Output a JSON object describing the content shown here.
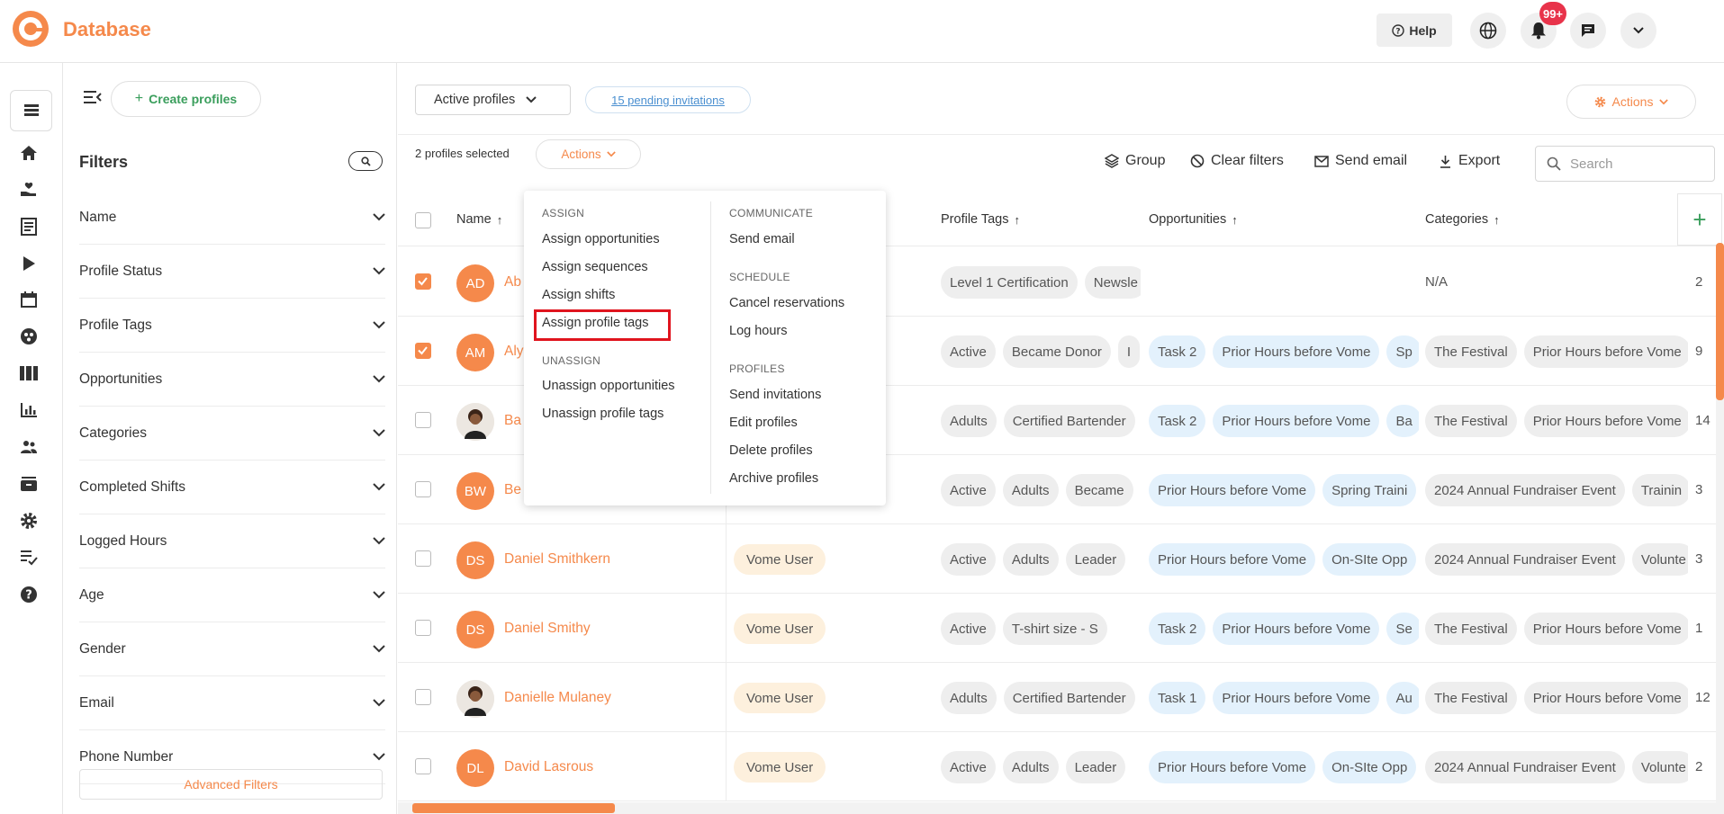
{
  "app": {
    "brand": "Database"
  },
  "header": {
    "help_label": "Help",
    "notif_badge": "99+"
  },
  "sidebar": {
    "create_label": "Create profiles",
    "filters_title": "Filters",
    "filters": [
      "Name",
      "Profile Status",
      "Profile Tags",
      "Opportunities",
      "Categories",
      "Completed Shifts",
      "Logged Hours",
      "Age",
      "Gender",
      "Email",
      "Phone Number"
    ],
    "advanced_label": "Advanced Filters"
  },
  "toolbar": {
    "view_select": "Active profiles",
    "pending_link": "15 pending invitations",
    "actions_label": "Actions",
    "selected_text": "2 profiles selected",
    "sel_actions_label": "Actions",
    "group_label": "Group",
    "clear_label": "Clear filters",
    "email_label": "Send email",
    "export_label": "Export",
    "search_placeholder": "Search"
  },
  "table": {
    "headers": {
      "name": "Name",
      "tags": "Profile Tags",
      "opps": "Opportunities",
      "cats": "Categories"
    },
    "rows": [
      {
        "initials": "AD",
        "name": "Ab",
        "checked": true,
        "role": "",
        "tags": [
          "Level 1 Certification",
          "Newsle"
        ],
        "opps": [],
        "cats": [
          "N/A"
        ],
        "extra": "2",
        "photo": false
      },
      {
        "initials": "AM",
        "name": "Aly",
        "checked": true,
        "role": "",
        "tags": [
          "Active",
          "Became Donor",
          "I"
        ],
        "opps": [
          "Task 2",
          "Prior Hours before Vome",
          "Sp"
        ],
        "cats": [
          "The Festival",
          "Prior Hours before Vome"
        ],
        "extra": "9",
        "photo": false
      },
      {
        "initials": "",
        "name": "Ba",
        "checked": false,
        "role": "",
        "tags": [
          "Adults",
          "Certified Bartender"
        ],
        "opps": [
          "Task 2",
          "Prior Hours before Vome",
          "Ba"
        ],
        "cats": [
          "The Festival",
          "Prior Hours before Vome"
        ],
        "extra": "14",
        "photo": true
      },
      {
        "initials": "BW",
        "name": "Be",
        "checked": false,
        "role": "",
        "tags": [
          "Active",
          "Adults",
          "Became"
        ],
        "opps": [
          "Prior Hours before Vome",
          "Spring Traini"
        ],
        "cats": [
          "2024 Annual Fundraiser Event",
          "Trainin"
        ],
        "extra": "3",
        "photo": false
      },
      {
        "initials": "DS",
        "name": "Daniel Smithkern",
        "checked": false,
        "role": "Vome User",
        "tags": [
          "Active",
          "Adults",
          "Leader"
        ],
        "opps": [
          "Prior Hours before Vome",
          "On-SIte Opp"
        ],
        "cats": [
          "2024 Annual Fundraiser Event",
          "Volunte"
        ],
        "extra": "3",
        "photo": false
      },
      {
        "initials": "DS",
        "name": "Daniel Smithy",
        "checked": false,
        "role": "Vome User",
        "tags": [
          "Active",
          "T-shirt size - S"
        ],
        "opps": [
          "Task 2",
          "Prior Hours before Vome",
          "Se"
        ],
        "cats": [
          "The Festival",
          "Prior Hours before Vome"
        ],
        "extra": "1",
        "photo": false
      },
      {
        "initials": "",
        "name": "Danielle Mulaney",
        "checked": false,
        "role": "Vome User",
        "tags": [
          "Adults",
          "Certified Bartender"
        ],
        "opps": [
          "Task 1",
          "Prior Hours before Vome",
          "Au"
        ],
        "cats": [
          "The Festival",
          "Prior Hours before Vome"
        ],
        "extra": "12",
        "photo": true
      },
      {
        "initials": "DL",
        "name": "David Lasrous",
        "checked": false,
        "role": "Vome User",
        "tags": [
          "Active",
          "Adults",
          "Leader"
        ],
        "opps": [
          "Prior Hours before Vome",
          "On-SIte Opp"
        ],
        "cats": [
          "2024 Annual Fundraiser Event",
          "Volunte"
        ],
        "extra": "2",
        "photo": false
      }
    ]
  },
  "menu": {
    "assign_head": "ASSIGN",
    "assign": [
      "Assign opportunities",
      "Assign sequences",
      "Assign shifts",
      "Assign profile tags"
    ],
    "unassign_head": "UNASSIGN",
    "unassign": [
      "Unassign opportunities",
      "Unassign profile tags"
    ],
    "communicate_head": "COMMUNICATE",
    "communicate": [
      "Send email"
    ],
    "schedule_head": "SCHEDULE",
    "schedule": [
      "Cancel reservations",
      "Log hours"
    ],
    "profiles_head": "PROFILES",
    "profiles": [
      "Send invitations",
      "Edit profiles",
      "Delete profiles",
      "Archive profiles"
    ]
  },
  "colors": {
    "accent": "#f5894b",
    "green": "#3a9e5c",
    "highlight": "#e0141e"
  }
}
